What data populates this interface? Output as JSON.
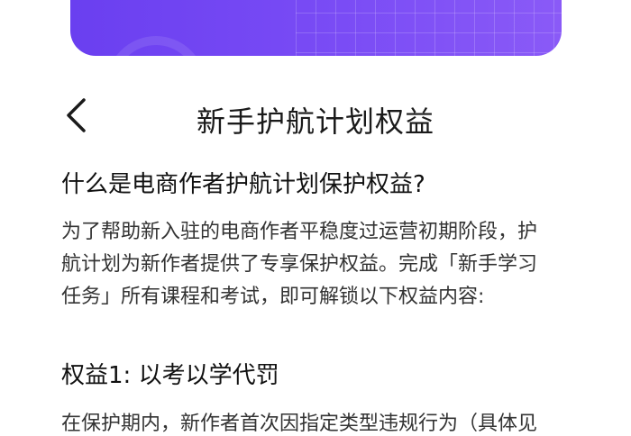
{
  "header": {
    "title": "新手护航计划权益",
    "back_icon": "chevron-left-icon"
  },
  "banner": {
    "color_start": "#6a3ff0",
    "color_end": "#8a5af7"
  },
  "section": {
    "question": "什么是电商作者护航计划保护权益?",
    "intro_lines": [
      "为了帮助新入驻的电商作者平稳度过运营初期阶段，护",
      "航计划为新作者提供了专享保护权益。完成「新手学习",
      "任务」所有课程和考试，即可解锁以下权益内容:"
    ]
  },
  "benefit1": {
    "title": "权益1: 以考以学代罚",
    "desc_partial": "在保护期内，新作者首次因指定类型违规行为（具体见"
  }
}
